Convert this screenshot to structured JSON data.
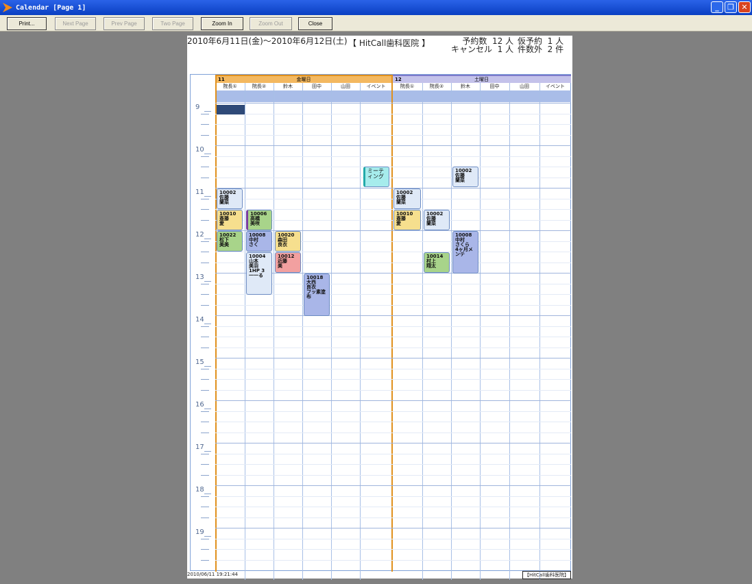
{
  "window": {
    "title": "Calendar [Page 1]"
  },
  "toolbar": {
    "print": "Print...",
    "next_page": "Next Page",
    "prev_page": "Prev Page",
    "two_page": "Two Page",
    "zoom_in": "Zoom In",
    "zoom_out": "Zoom Out",
    "close": "Close"
  },
  "report": {
    "date_range": "2010年6月11日(金)〜2010年6月12日(土)",
    "clinic": "【 HitCall歯科医院 】",
    "counts_a": "予約数  12 人\nキャンセル  1 人",
    "counts_b": "仮予約  1 人\n件数外  2 件",
    "footer_timestamp": "2010/06/11 19:21:44",
    "footer_clinic": "【HitCall歯科医院】"
  },
  "days": [
    {
      "num": "11",
      "name": "金曜日",
      "columns": [
        "院長①",
        "院長②",
        "鈴木",
        "田中",
        "山田",
        "イベント"
      ]
    },
    {
      "num": "12",
      "name": "土曜日",
      "columns": [
        "院長①",
        "院長②",
        "鈴木",
        "田中",
        "山田",
        "イベント"
      ]
    }
  ],
  "hours": [
    "9",
    "10",
    "11",
    "12",
    "13",
    "14",
    "15",
    "16",
    "17",
    "18",
    "19"
  ],
  "appointments": [
    {
      "text": "10002\n佐藤\n蘭菜",
      "color": "#dfe9f7"
    },
    {
      "text": "10010\n斎藤\n愛",
      "color": "#f6df8e"
    },
    {
      "text": "10006\n高橋\n美咲",
      "color": "#a8d48a"
    },
    {
      "text": "10022\n松下\n美美",
      "color": "#a8d48a"
    },
    {
      "text": "10008\n中村\nさく",
      "color": "#a9b6e8"
    },
    {
      "text": "10020\n森田\n良衣",
      "color": "#f6df8e"
    },
    {
      "text": "10004\n山本\n美羽\n1HP 3\n一一る",
      "color": "#dfe9f7"
    },
    {
      "text": "10012\n近藤\n美",
      "color": "#f2a0a0"
    },
    {
      "text": "10018\n大西\n良衣\nフッ素塗布",
      "color": "#a9b6e8"
    },
    {
      "text": "ミーティング",
      "color": "#a6ecec"
    },
    {
      "text": "10002\n佐藤\n蘭菜",
      "color": "#dfe9f7"
    },
    {
      "text": "10002\n佐藤\n蘭菜",
      "color": "#dfe9f7"
    },
    {
      "text": "10010\n斎藤\n愛",
      "color": "#f6df8e"
    },
    {
      "text": "10002\n佐藤\n蘭菜",
      "color": "#dfe9f7"
    },
    {
      "text": "10008\n中村\nさくら\n4ヶ月メンテ",
      "color": "#a9b6e8"
    },
    {
      "text": "10014\n村上\n翔太",
      "color": "#a8d48a"
    }
  ]
}
